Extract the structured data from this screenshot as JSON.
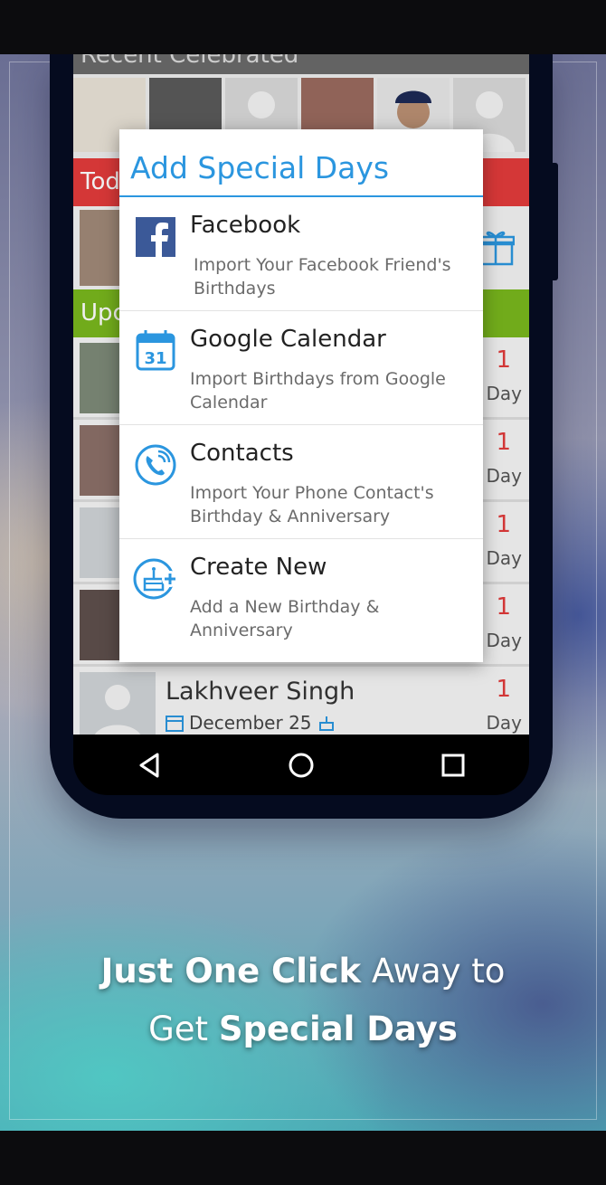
{
  "app": {
    "sections": {
      "recent": "Recent Celebrated",
      "today": "Today",
      "upcoming": "Upcoming"
    },
    "rows": [
      {
        "name": "",
        "date": "",
        "days_num": "1",
        "days_label": "Day"
      },
      {
        "name": "",
        "date": "",
        "days_num": "1",
        "days_label": "Day"
      },
      {
        "name": "",
        "date": "",
        "days_num": "1",
        "days_label": "Day"
      },
      {
        "name": "",
        "date": "",
        "days_num": "1",
        "days_label": "Day"
      },
      {
        "name": "Lakhveer Singh",
        "date": "December 25",
        "days_num": "1",
        "days_label": "Day"
      }
    ]
  },
  "dialog": {
    "title": "Add Special Days",
    "options": [
      {
        "icon": "facebook-icon",
        "title": "Facebook",
        "subtitle": "Import Your Facebook Friend's Birthdays"
      },
      {
        "icon": "calendar-icon",
        "title": "Google Calendar",
        "subtitle": "Import Birthdays from Google Calendar",
        "icon_text": "31"
      },
      {
        "icon": "phone-icon",
        "title": "Contacts",
        "subtitle": "Import Your Phone Contact's Birthday & Anniversary"
      },
      {
        "icon": "cake-add-icon",
        "title": "Create New",
        "subtitle": "Add a New Birthday & Anniversary"
      }
    ]
  },
  "caption": {
    "line1_bold": "Just One Click",
    "line1_rest": " Away to",
    "line2_pre": "Get ",
    "line2_bold": "Special Days"
  },
  "colors": {
    "accent": "#2b96df",
    "today": "#e23b3b",
    "upcoming": "#79b61d",
    "days": "#e03a3a"
  }
}
